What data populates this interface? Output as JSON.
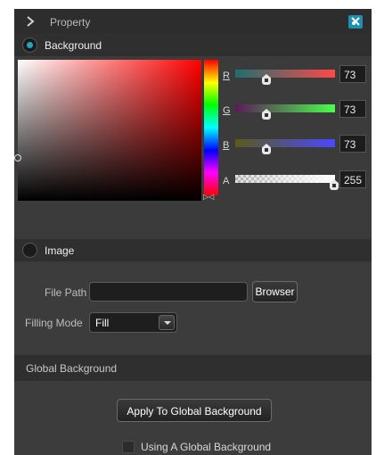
{
  "window": {
    "title": "Property",
    "collapse_icon": "chevron-right-icon",
    "pin_icon": "pin-icon"
  },
  "background": {
    "label": "Background",
    "selected": true,
    "channels": [
      {
        "label": "R",
        "value": "73",
        "level": 0.29,
        "gradient": [
          "#494949",
          "#ff4949"
        ]
      },
      {
        "label": "G",
        "value": "73",
        "level": 0.29,
        "gradient": [
          "#494949",
          "#49ff49"
        ]
      },
      {
        "label": "B",
        "value": "73",
        "level": 0.29,
        "gradient": [
          "#494949",
          "#4949ff"
        ]
      },
      {
        "label": "A",
        "value": "255",
        "level": 1.0,
        "gradient": [
          "checker",
          "#ffffff"
        ]
      }
    ],
    "current_color": "#494949"
  },
  "image": {
    "label": "Image",
    "selected": false,
    "file_path_label": "File Path",
    "file_path_value": "",
    "browse_label": "Browser",
    "filling_mode_label": "Filling Mode",
    "filling_mode_value": "Fill"
  },
  "global": {
    "header": "Global Background",
    "apply_label": "Apply To Global Background",
    "checkbox_label": "Using A Global Background",
    "checkbox_checked": false
  },
  "colors": {
    "accent": "#1fa6b8",
    "panel_bg": "#3a3a3a",
    "header_bg": "#2f2f2f"
  }
}
